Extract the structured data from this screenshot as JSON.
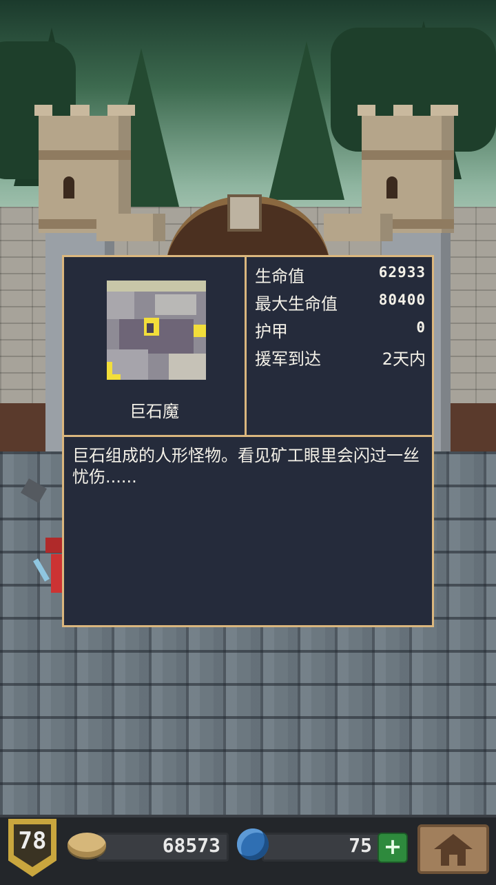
{
  "monster": {
    "name": "巨石魔",
    "description": "巨石组成的人形怪物。看见矿工眼里会闪过一丝忧伤......"
  },
  "stats": [
    {
      "label": "生命值",
      "value": "62933"
    },
    {
      "label": "最大生命值",
      "value": "80400"
    },
    {
      "label": "护甲",
      "value": "0"
    },
    {
      "label": "援军到达",
      "value": "2天内"
    }
  ],
  "hud": {
    "level": "78",
    "gold": "68573",
    "gems": "75",
    "add_label": "+"
  },
  "colors": {
    "panel_bg": "#252b3b",
    "panel_border": "#dbb77e",
    "text": "#f4f1e8",
    "badge_gold": "#c9a63e"
  },
  "icons": [
    "monster-portrait",
    "coin-icon",
    "gem-icon",
    "plus-icon",
    "home-icon",
    "level-badge"
  ]
}
